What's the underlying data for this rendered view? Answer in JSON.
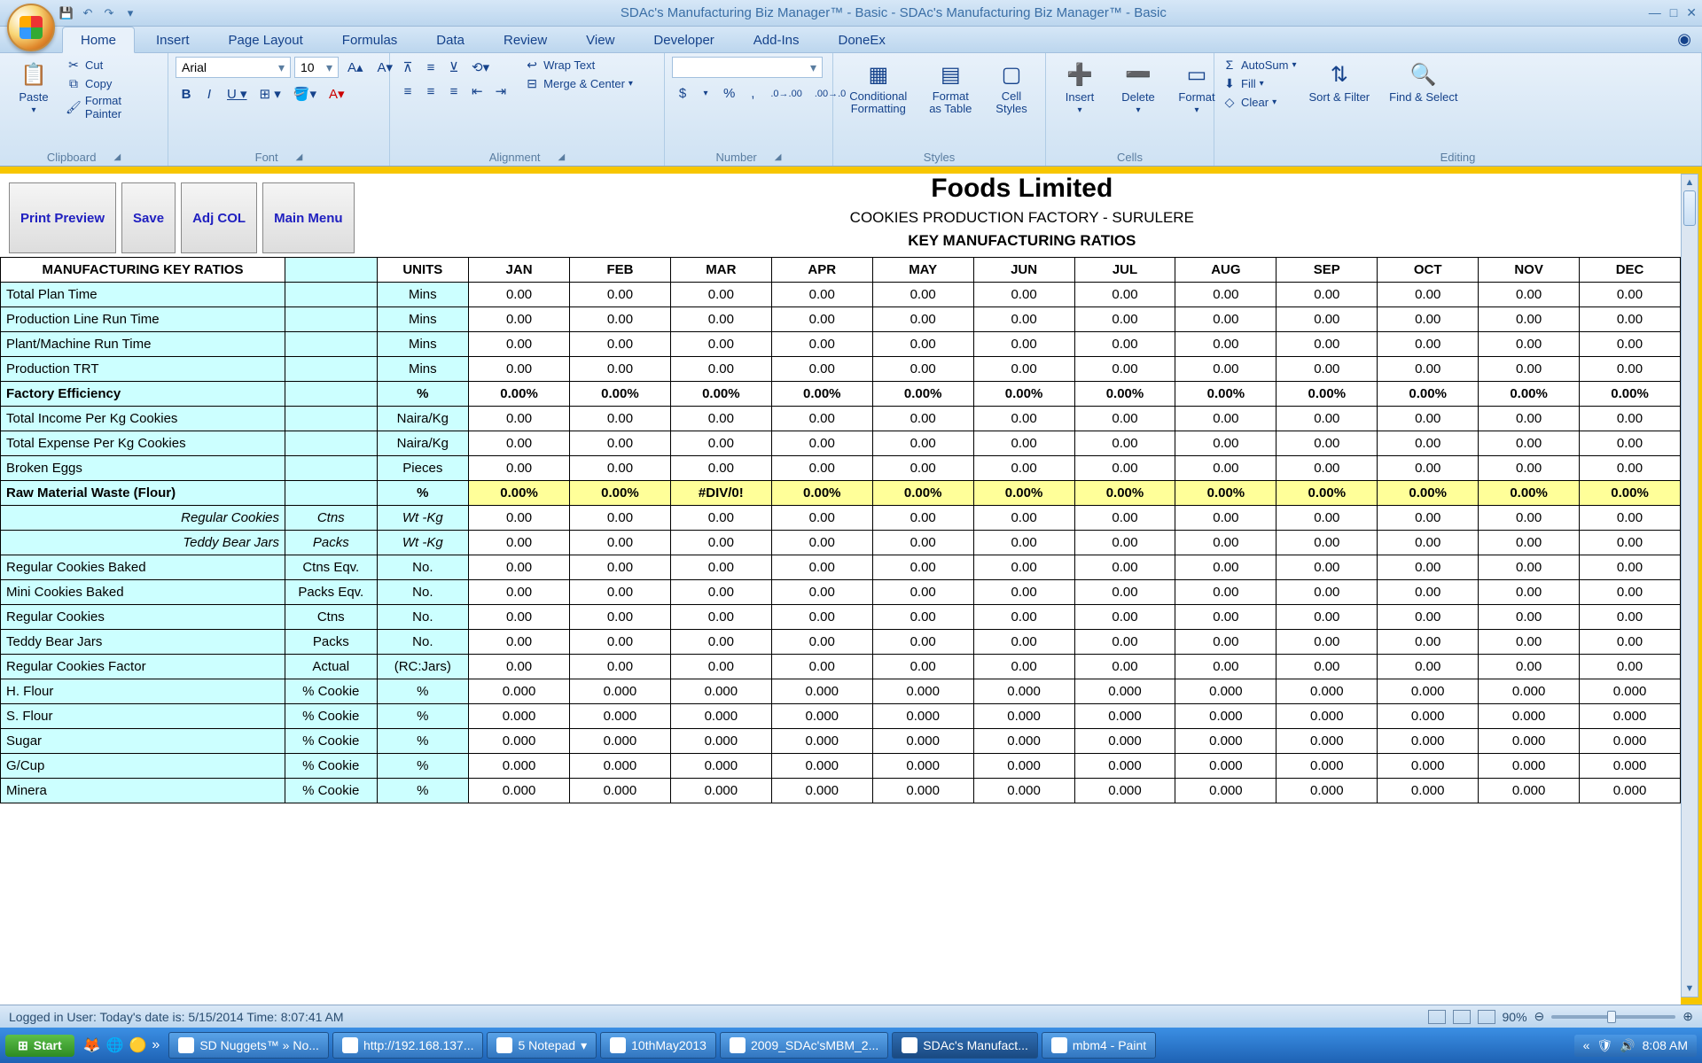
{
  "title": "SDAc's Manufacturing Biz Manager™ - Basic - SDAc's Manufacturing Biz Manager™ - Basic",
  "tabs": [
    "Home",
    "Insert",
    "Page Layout",
    "Formulas",
    "Data",
    "Review",
    "View",
    "Developer",
    "Add-Ins",
    "DoneEx"
  ],
  "ribbon": {
    "clipboard": {
      "paste": "Paste",
      "cut": "Cut",
      "copy": "Copy",
      "format_painter": "Format Painter",
      "label": "Clipboard"
    },
    "font": {
      "name": "Arial",
      "size": "10",
      "label": "Font"
    },
    "alignment": {
      "wrap": "Wrap Text",
      "merge": "Merge & Center",
      "label": "Alignment"
    },
    "number": {
      "currency": "$",
      "percent": "%",
      "comma": ",",
      "inc": ".0 .00",
      "dec": ".00 .0",
      "label": "Number"
    },
    "styles": {
      "cond": "Conditional Formatting",
      "table": "Format as Table",
      "cell": "Cell Styles",
      "label": "Styles"
    },
    "cells": {
      "insert": "Insert",
      "delete": "Delete",
      "format": "Format",
      "label": "Cells"
    },
    "editing": {
      "autosum": "AutoSum",
      "fill": "Fill",
      "clear": "Clear",
      "sort": "Sort & Filter",
      "find": "Find & Select",
      "label": "Editing"
    }
  },
  "app_buttons": [
    "Print Preview",
    "Save",
    "Adj COL",
    "Main Menu"
  ],
  "report": {
    "company": "Foods Limited",
    "sub1": "COOKIES PRODUCTION FACTORY - SURULERE",
    "sub2": "KEY MANUFACTURING RATIOS"
  },
  "columns": [
    "MANUFACTURING KEY RATIOS",
    "",
    "UNITS",
    "JAN",
    "FEB",
    "MAR",
    "APR",
    "MAY",
    "JUN",
    "JUL",
    "AUG",
    "SEP",
    "OCT",
    "NOV",
    "DEC"
  ],
  "months": [
    "JAN",
    "FEB",
    "MAR",
    "APR",
    "MAY",
    "JUN",
    "JUL",
    "AUG",
    "SEP",
    "OCT",
    "NOV",
    "DEC"
  ],
  "rows": [
    {
      "label": "Total Plan Time",
      "sub": "",
      "unit": "Mins",
      "vals": [
        "0.00",
        "0.00",
        "0.00",
        "0.00",
        "0.00",
        "0.00",
        "0.00",
        "0.00",
        "0.00",
        "0.00",
        "0.00",
        "0.00"
      ]
    },
    {
      "label": "Production Line Run Time",
      "sub": "",
      "unit": "Mins",
      "vals": [
        "0.00",
        "0.00",
        "0.00",
        "0.00",
        "0.00",
        "0.00",
        "0.00",
        "0.00",
        "0.00",
        "0.00",
        "0.00",
        "0.00"
      ]
    },
    {
      "label": "Plant/Machine Run Time",
      "sub": "",
      "unit": "Mins",
      "vals": [
        "0.00",
        "0.00",
        "0.00",
        "0.00",
        "0.00",
        "0.00",
        "0.00",
        "0.00",
        "0.00",
        "0.00",
        "0.00",
        "0.00"
      ]
    },
    {
      "label": "Production TRT",
      "sub": "",
      "unit": "Mins",
      "vals": [
        "0.00",
        "0.00",
        "0.00",
        "0.00",
        "0.00",
        "0.00",
        "0.00",
        "0.00",
        "0.00",
        "0.00",
        "0.00",
        "0.00"
      ]
    },
    {
      "label": "Factory Efficiency",
      "sub": "",
      "unit": "%",
      "vals": [
        "0.00%",
        "0.00%",
        "0.00%",
        "0.00%",
        "0.00%",
        "0.00%",
        "0.00%",
        "0.00%",
        "0.00%",
        "0.00%",
        "0.00%",
        "0.00%"
      ],
      "bold": true
    },
    {
      "label": "Total Income Per Kg Cookies",
      "sub": "",
      "unit": "Naira/Kg",
      "vals": [
        "0.00",
        "0.00",
        "0.00",
        "0.00",
        "0.00",
        "0.00",
        "0.00",
        "0.00",
        "0.00",
        "0.00",
        "0.00",
        "0.00"
      ]
    },
    {
      "label": "Total Expense Per Kg Cookies",
      "sub": "",
      "unit": "Naira/Kg",
      "vals": [
        "0.00",
        "0.00",
        "0.00",
        "0.00",
        "0.00",
        "0.00",
        "0.00",
        "0.00",
        "0.00",
        "0.00",
        "0.00",
        "0.00"
      ]
    },
    {
      "label": "Broken Eggs",
      "sub": "",
      "unit": "Pieces",
      "vals": [
        "0.00",
        "0.00",
        "0.00",
        "0.00",
        "0.00",
        "0.00",
        "0.00",
        "0.00",
        "0.00",
        "0.00",
        "0.00",
        "0.00"
      ]
    },
    {
      "label": "Raw Material Waste (Flour)",
      "sub": "",
      "unit": "%",
      "vals": [
        "0.00%",
        "0.00%",
        "#DIV/0!",
        "0.00%",
        "0.00%",
        "0.00%",
        "0.00%",
        "0.00%",
        "0.00%",
        "0.00%",
        "0.00%",
        "0.00%"
      ],
      "bold": true,
      "ylw": true
    },
    {
      "label": "Regular Cookies",
      "sub": "Ctns",
      "unit": "Wt -Kg",
      "italic": true,
      "vals": [
        "0.00",
        "0.00",
        "0.00",
        "0.00",
        "0.00",
        "0.00",
        "0.00",
        "0.00",
        "0.00",
        "0.00",
        "0.00",
        "0.00"
      ]
    },
    {
      "label": "Teddy Bear Jars",
      "sub": "Packs",
      "unit": "Wt -Kg",
      "italic": true,
      "vals": [
        "0.00",
        "0.00",
        "0.00",
        "0.00",
        "0.00",
        "0.00",
        "0.00",
        "0.00",
        "0.00",
        "0.00",
        "0.00",
        "0.00"
      ]
    },
    {
      "label": "Regular Cookies Baked",
      "sub": "Ctns Eqv.",
      "unit": "No.",
      "vals": [
        "0.00",
        "0.00",
        "0.00",
        "0.00",
        "0.00",
        "0.00",
        "0.00",
        "0.00",
        "0.00",
        "0.00",
        "0.00",
        "0.00"
      ]
    },
    {
      "label": "Mini Cookies Baked",
      "sub": "Packs Eqv.",
      "unit": "No.",
      "vals": [
        "0.00",
        "0.00",
        "0.00",
        "0.00",
        "0.00",
        "0.00",
        "0.00",
        "0.00",
        "0.00",
        "0.00",
        "0.00",
        "0.00"
      ]
    },
    {
      "label": "Regular Cookies",
      "sub": "Ctns",
      "unit": "No.",
      "vals": [
        "0.00",
        "0.00",
        "0.00",
        "0.00",
        "0.00",
        "0.00",
        "0.00",
        "0.00",
        "0.00",
        "0.00",
        "0.00",
        "0.00"
      ]
    },
    {
      "label": "Teddy Bear Jars",
      "sub": "Packs",
      "unit": "No.",
      "vals": [
        "0.00",
        "0.00",
        "0.00",
        "0.00",
        "0.00",
        "0.00",
        "0.00",
        "0.00",
        "0.00",
        "0.00",
        "0.00",
        "0.00"
      ]
    },
    {
      "label": "Regular Cookies Factor",
      "sub": "Actual",
      "unit": "(RC:Jars)",
      "vals": [
        "0.00",
        "0.00",
        "0.00",
        "0.00",
        "0.00",
        "0.00",
        "0.00",
        "0.00",
        "0.00",
        "0.00",
        "0.00",
        "0.00"
      ]
    },
    {
      "label": "H. Flour",
      "sub": "% Cookie",
      "unit": "%",
      "vals": [
        "0.000",
        "0.000",
        "0.000",
        "0.000",
        "0.000",
        "0.000",
        "0.000",
        "0.000",
        "0.000",
        "0.000",
        "0.000",
        "0.000"
      ]
    },
    {
      "label": "S. Flour",
      "sub": "% Cookie",
      "unit": "%",
      "vals": [
        "0.000",
        "0.000",
        "0.000",
        "0.000",
        "0.000",
        "0.000",
        "0.000",
        "0.000",
        "0.000",
        "0.000",
        "0.000",
        "0.000"
      ]
    },
    {
      "label": "Sugar",
      "sub": "% Cookie",
      "unit": "%",
      "vals": [
        "0.000",
        "0.000",
        "0.000",
        "0.000",
        "0.000",
        "0.000",
        "0.000",
        "0.000",
        "0.000",
        "0.000",
        "0.000",
        "0.000"
      ]
    },
    {
      "label": "G/Cup",
      "sub": "% Cookie",
      "unit": "%",
      "vals": [
        "0.000",
        "0.000",
        "0.000",
        "0.000",
        "0.000",
        "0.000",
        "0.000",
        "0.000",
        "0.000",
        "0.000",
        "0.000",
        "0.000"
      ]
    },
    {
      "label": "Minera",
      "sub": "% Cookie",
      "unit": "%",
      "vals": [
        "0.000",
        "0.000",
        "0.000",
        "0.000",
        "0.000",
        "0.000",
        "0.000",
        "0.000",
        "0.000",
        "0.000",
        "0.000",
        "0.000"
      ]
    }
  ],
  "status": "Logged in User:  Today's date is: 5/15/2014 Time: 8:07:41 AM",
  "zoom": "90%",
  "taskbar": {
    "start": "Start",
    "items": [
      {
        "label": "SD Nuggets™ » No..."
      },
      {
        "label": "http://192.168.137..."
      },
      {
        "label": "5 Notepad",
        "dd": true
      },
      {
        "label": "10thMay2013"
      },
      {
        "label": "2009_SDAc'sMBM_2..."
      },
      {
        "label": "SDAc's Manufact...",
        "active": true
      },
      {
        "label": "mbm4 - Paint"
      }
    ],
    "time": "8:08 AM"
  }
}
